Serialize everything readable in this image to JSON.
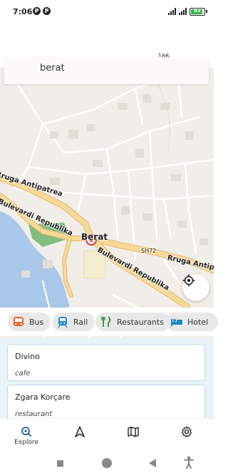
{
  "status_bar": {
    "time": "7:06",
    "app_icons": [
      "P",
      "P"
    ],
    "battery_level": "82"
  },
  "search": {
    "query": "berat"
  },
  "map": {
    "town_label": "Berat",
    "street_labels": {
      "antipatrea": "Rruga Antipatrea",
      "republika_west": "Bulevardi Republika",
      "republika_east": "Bulevardi Republika",
      "sh72": "SH72",
      "rruga_antip": "Rruga Antip",
      "elevation": "166"
    }
  },
  "categories": [
    {
      "label": "Bus",
      "icon": "bus-icon",
      "color": "#e8612c"
    },
    {
      "label": "Rail",
      "icon": "train-icon",
      "color": "#1e88c8"
    },
    {
      "label": "Restaurants",
      "icon": "cutlery-icon",
      "color": "#3b8a3e"
    },
    {
      "label": "Hotel",
      "icon": "bed-icon",
      "color": "#1e88c8"
    }
  ],
  "results": [
    {
      "name": "Divino",
      "type": "cafe"
    },
    {
      "name": "Zgara Korçare",
      "type": "restaurant"
    }
  ],
  "bottom_nav": {
    "explore_label": "Explore"
  },
  "colors": {
    "accent": "#1f5fa0",
    "map_background": "#f1eeea",
    "major_road": "#f6d998",
    "water": "#a9c7e8",
    "park": "#6db36d"
  }
}
